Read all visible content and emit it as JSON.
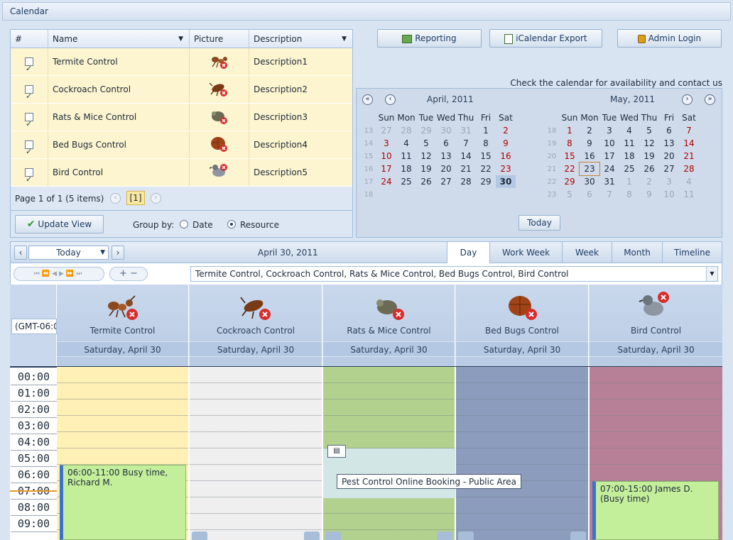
{
  "window": {
    "title": "Calendar"
  },
  "resource_grid": {
    "columns": [
      "#",
      "Name",
      "Picture",
      "Description"
    ],
    "rows": [
      {
        "name": "Termite Control",
        "description": "Description1",
        "checked": true,
        "icon": "ant-icon"
      },
      {
        "name": "Cockroach Control",
        "description": "Description2",
        "checked": true,
        "icon": "cockroach-icon"
      },
      {
        "name": "Rats & Mice Control",
        "description": "Description3",
        "checked": true,
        "icon": "rat-icon"
      },
      {
        "name": "Bed Bugs Control",
        "description": "Description4",
        "checked": true,
        "icon": "bedbug-icon"
      },
      {
        "name": "Bird Control",
        "description": "Description5",
        "checked": true,
        "icon": "pigeon-icon"
      }
    ],
    "pager": {
      "text": "Page 1 of 1 (5 items)",
      "current": "[1]"
    },
    "update_button": "Update View",
    "group_by": {
      "label": "Group by:",
      "date": "Date",
      "resource": "Resource",
      "selected": "Resource"
    }
  },
  "toolbar": {
    "reporting": "Reporting",
    "ical_export": "iCalendar Export",
    "admin_login": "Admin Login"
  },
  "availability_note": "Check the calendar for availability and contact us",
  "mini_calendar": {
    "day_names": [
      "Sun",
      "Mon",
      "Tue",
      "Wed",
      "Thu",
      "Fri",
      "Sat"
    ],
    "left": {
      "title": "April, 2011",
      "weeks": [
        {
          "wk": "13",
          "days": [
            "27",
            "28",
            "29",
            "30",
            "31",
            "1",
            "2"
          ]
        },
        {
          "wk": "14",
          "days": [
            "3",
            "4",
            "5",
            "6",
            "7",
            "8",
            "9"
          ]
        },
        {
          "wk": "15",
          "days": [
            "10",
            "11",
            "12",
            "13",
            "14",
            "15",
            "16"
          ]
        },
        {
          "wk": "16",
          "days": [
            "17",
            "18",
            "19",
            "20",
            "21",
            "22",
            "23"
          ]
        },
        {
          "wk": "17",
          "days": [
            "24",
            "25",
            "26",
            "27",
            "28",
            "29",
            "30"
          ]
        },
        {
          "wk": "18",
          "days": [
            "",
            "",
            "",
            "",
            "",
            "",
            ""
          ]
        }
      ]
    },
    "right": {
      "title": "May, 2011",
      "weeks": [
        {
          "wk": "18",
          "days": [
            "1",
            "2",
            "3",
            "4",
            "5",
            "6",
            "7"
          ]
        },
        {
          "wk": "19",
          "days": [
            "8",
            "9",
            "10",
            "11",
            "12",
            "13",
            "14"
          ]
        },
        {
          "wk": "20",
          "days": [
            "15",
            "16",
            "17",
            "18",
            "19",
            "20",
            "21"
          ]
        },
        {
          "wk": "21",
          "days": [
            "22",
            "23",
            "24",
            "25",
            "26",
            "27",
            "28"
          ]
        },
        {
          "wk": "22",
          "days": [
            "29",
            "30",
            "31",
            "1",
            "2",
            "3",
            "4"
          ]
        },
        {
          "wk": "23",
          "days": [
            "5",
            "6",
            "7",
            "8",
            "9",
            "10",
            "11"
          ]
        }
      ]
    },
    "today_button": "Today"
  },
  "scheduler": {
    "nav_today": "Today",
    "date_label": "April 30, 2011",
    "views": [
      "Day",
      "Work Week",
      "Week",
      "Month",
      "Timeline"
    ],
    "active_view": "Day",
    "resource_filter": "Termite Control, Cockroach Control, Rats & Mice Control, Bed Bugs Control, Bird Control",
    "timezone": "(GMT-06:0",
    "resources": [
      {
        "name": "Termite Control",
        "date": "Saturday, April 30",
        "color": "#fff0b5"
      },
      {
        "name": "Cockroach Control",
        "date": "Saturday, April 30",
        "color": "#efefef"
      },
      {
        "name": "Rats & Mice Control",
        "date": "Saturday, April 30",
        "color": "#b3d18e"
      },
      {
        "name": "Bed Bugs Control",
        "date": "Saturday, April 30",
        "color": "#8b9cbd"
      },
      {
        "name": "Bird Control",
        "date": "Saturday, April 30",
        "color": "#b88097"
      }
    ],
    "hours": [
      "00:00",
      "01:00",
      "02:00",
      "03:00",
      "04:00",
      "05:00",
      "06:00",
      "07:00",
      "08:00",
      "09:00"
    ],
    "events": [
      {
        "text": "06:00-11:00 Busy time, Richard M."
      },
      {
        "text": "07:00-15:00 James D. (Busy time)"
      }
    ],
    "tooltip": "Pest Control Online Booking - Public Area"
  }
}
